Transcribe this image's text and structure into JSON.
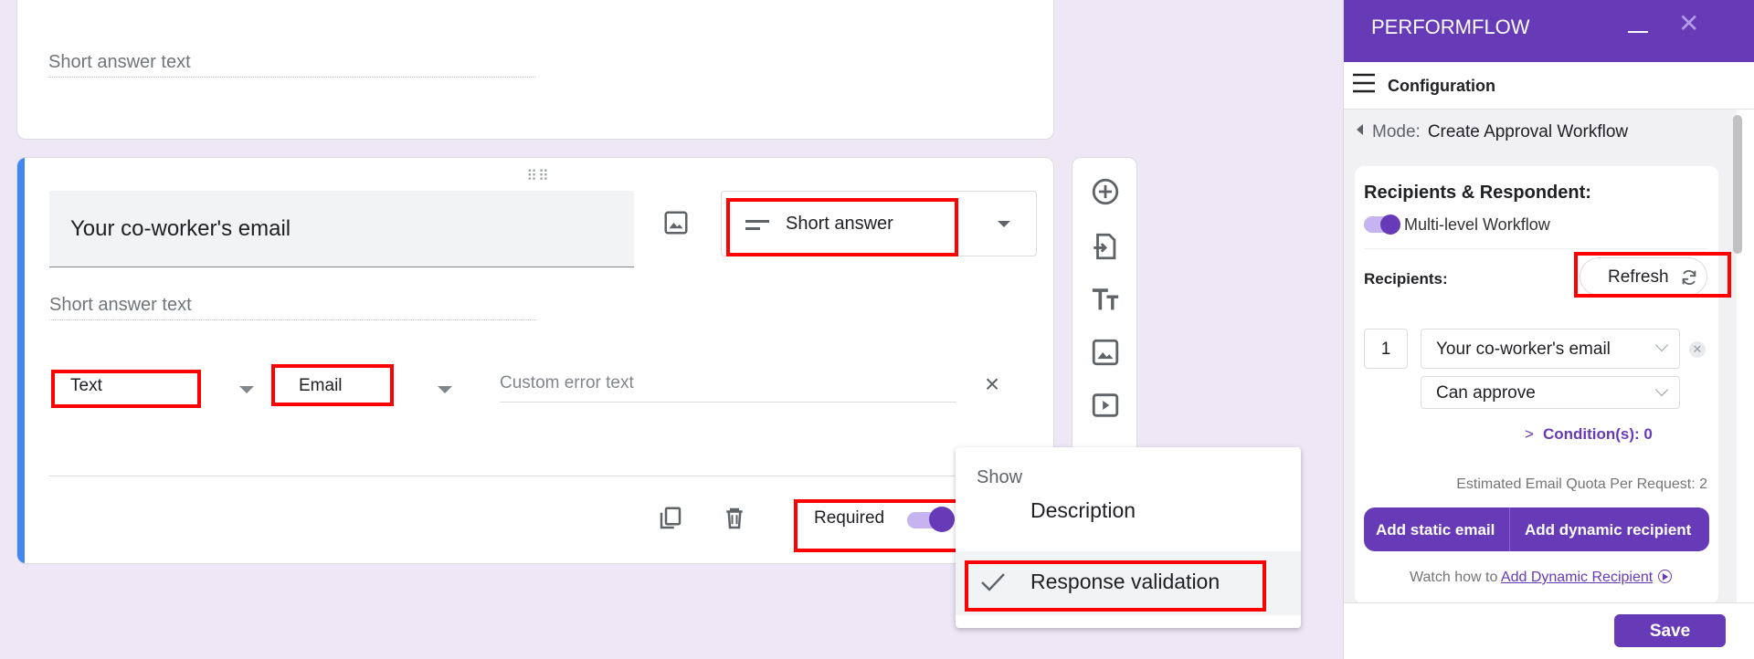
{
  "form": {
    "short_answer_placeholder": "Short answer text",
    "question_title": "Your co-worker's email",
    "question_type": "Short answer",
    "validation_type": "Text",
    "validation_rule": "Email",
    "custom_error_placeholder": "Custom error text",
    "required_label": "Required",
    "required": true,
    "menu": {
      "heading": "Show",
      "items": [
        {
          "label": "Description",
          "checked": false
        },
        {
          "label": "Response validation",
          "checked": true
        }
      ]
    }
  },
  "toolbar": {
    "icons": [
      "add-question-icon",
      "import-questions-icon",
      "add-title-icon",
      "add-image-icon",
      "add-video-icon"
    ]
  },
  "panel": {
    "title": "PERFORMFLOW",
    "config_label": "Configuration",
    "mode_key": "Mode:",
    "mode_value": "Create Approval Workflow",
    "rr_title": "Recipients & Respondent:",
    "multilevel_label": "Multi-level Workflow",
    "multilevel_enabled": true,
    "recipients_label": "Recipients:",
    "refresh_label": "Refresh",
    "recipient": {
      "index": "1",
      "field": "Your co-worker's email",
      "permission": "Can approve"
    },
    "conditions": "Condition(s): 0",
    "quota": "Estimated Email Quota Per Request: 2",
    "add_static": "Add static email",
    "add_dynamic": "Add dynamic recipient",
    "watch_prefix": "Watch how to",
    "watch_link": "Add Dynamic Recipient",
    "save_label": "Save"
  },
  "colors": {
    "background": "#ede7f6",
    "accent_purple": "#673ab7",
    "accent_blue": "#4285f4",
    "highlight_red": "#ff0000"
  }
}
